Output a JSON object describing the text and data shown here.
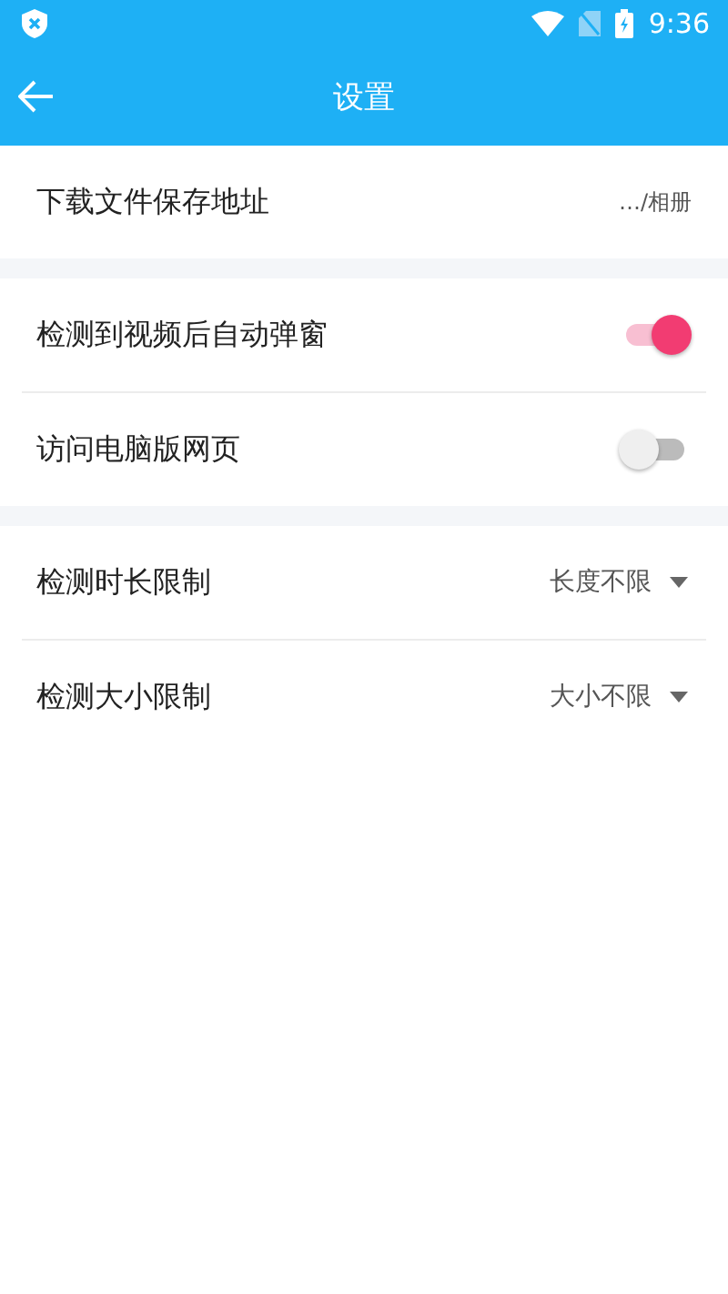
{
  "status_bar": {
    "time": "9:36"
  },
  "app_bar": {
    "title": "设置"
  },
  "sections": [
    {
      "items": [
        {
          "kind": "link",
          "label": "下载文件保存地址",
          "value": "…/相册"
        }
      ]
    },
    {
      "items": [
        {
          "kind": "switch",
          "label": "检测到视频后自动弹窗",
          "on": true
        },
        {
          "kind": "switch",
          "label": "访问电脑版网页",
          "on": false
        }
      ]
    },
    {
      "items": [
        {
          "kind": "dropdown",
          "label": "检测时长限制",
          "value": "长度不限"
        },
        {
          "kind": "dropdown",
          "label": "检测大小限制",
          "value": "大小不限"
        }
      ]
    }
  ]
}
